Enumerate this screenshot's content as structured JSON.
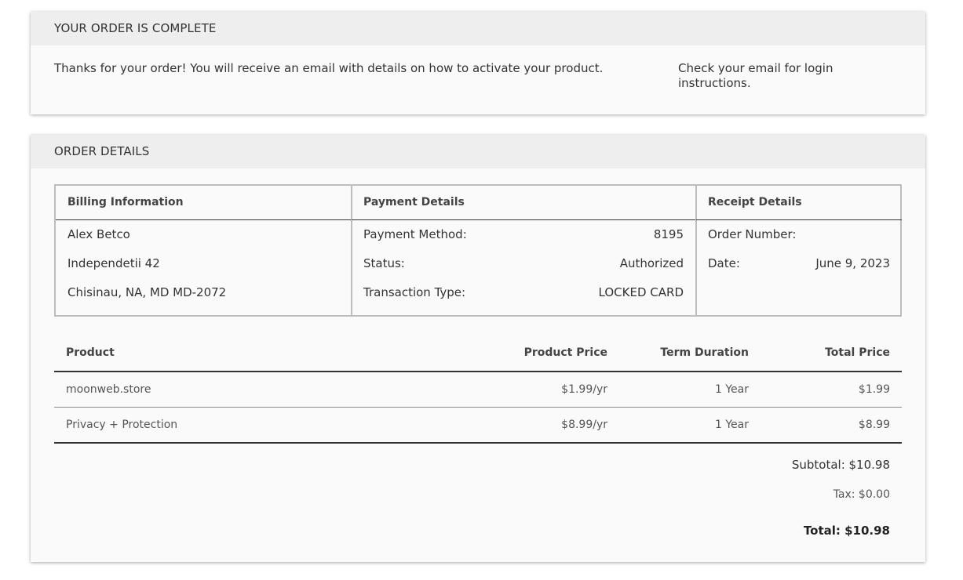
{
  "complete": {
    "title": "YOUR ORDER IS COMPLETE",
    "thanks_text": "Thanks for your order! You will receive an email with details on how to activate your product.",
    "check_email_text": "Check your email for login instructions."
  },
  "details": {
    "title": "ORDER DETAILS",
    "billing": {
      "heading": "Billing Information",
      "name": "Alex Betco",
      "street": "Independetii 42",
      "city_line": "Chisinau, NA, MD MD-2072"
    },
    "payment": {
      "heading": "Payment Details",
      "method_label": "Payment Method:",
      "method_value": "8195",
      "status_label": "Status:",
      "status_value": "Authorized",
      "type_label": "Transaction Type:",
      "type_value": "LOCKED CARD"
    },
    "receipt": {
      "heading": "Receipt Details",
      "order_label": "Order Number:",
      "order_value": "",
      "date_label": "Date:",
      "date_value": "June 9, 2023"
    },
    "products": {
      "headers": {
        "product": "Product",
        "price": "Product Price",
        "term": "Term Duration",
        "total": "Total Price"
      },
      "rows": [
        {
          "product": "moonweb.store",
          "price": "$1.99/yr",
          "term": "1 Year",
          "total": "$1.99"
        },
        {
          "product": "Privacy + Protection",
          "price": "$8.99/yr",
          "term": "1 Year",
          "total": "$8.99"
        }
      ]
    },
    "totals": {
      "subtotal": "Subtotal: $10.98",
      "tax": "Tax: $0.00",
      "total": "Total: $10.98"
    }
  }
}
